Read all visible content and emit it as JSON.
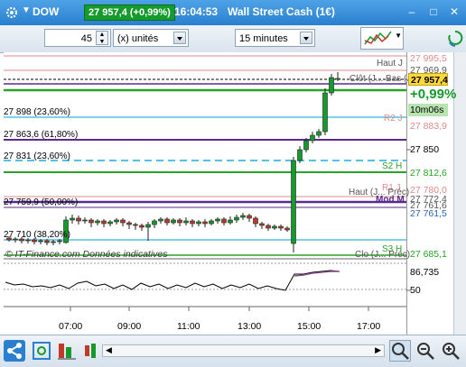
{
  "titlebar": {
    "symbol": "DOW",
    "price": "27 957,4 (+0,99%)",
    "time": "16:04:53",
    "instrument": "Wall Street Cash (1€)"
  },
  "toolbar": {
    "units_value": "45",
    "units_label": "(x) unités",
    "interval": "15 minutes"
  },
  "chart": {
    "levels": [
      {
        "label": "27 898 (23,60%)"
      },
      {
        "label": "27 863,6 (61,80%)"
      },
      {
        "label": "27 831 (23,60%)"
      },
      {
        "label": "27 759,9 (50,00%)"
      },
      {
        "label": "27 710 (38,20%)"
      }
    ],
    "names": {
      "haut_j": "Haut J",
      "cloture": "Clôt (J... Bas (J...",
      "r2": "R2 J",
      "s2": "S2 H",
      "r1": "R1 J",
      "haut_prec": "Haut (J... Préc)",
      "mid": "Mod M",
      "s3": "S3 H",
      "clo_prec": "Clo (J... Préc)"
    },
    "axis_tags": {
      "t1": "27 995,5",
      "t2": "27 969,9",
      "current": "27 957,4",
      "change": "+0,99%",
      "countdown": "10m06s",
      "t3": "27 883,9",
      "t4": "27 850",
      "t5": "27 812,6",
      "t6": "27 780,0",
      "t7": "27 772,4",
      "t8": "27 761,6",
      "t9": "27 761,5",
      "t10": "27 685,1",
      "osc1": "86,735",
      "osc2": "50"
    },
    "watermark": "© IT-Finance.com  Données indicatives",
    "xticks": [
      "07:00",
      "09:00",
      "11:00",
      "13:00",
      "15:00",
      "17:00"
    ]
  },
  "colors": {
    "up": "#159a2c",
    "down": "#c0392b",
    "accent": "#2a7fd0",
    "support": "#27a327",
    "pivot": "#5b2a91",
    "resistance": "#e28a8a",
    "cyan": "#4fc3e8"
  }
}
